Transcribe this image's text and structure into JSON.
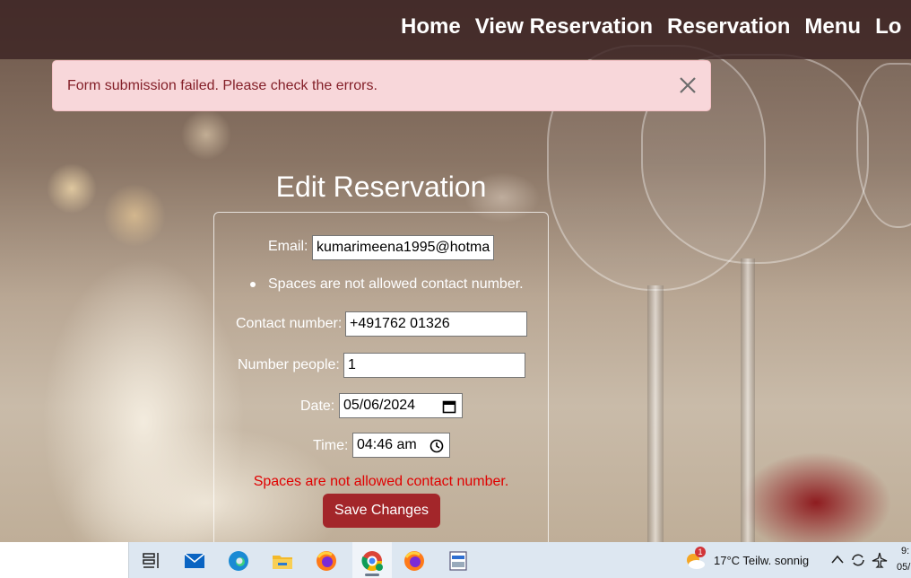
{
  "nav": {
    "items": [
      "Home",
      "View Reservation",
      "Reservation",
      "Menu",
      "Lo"
    ]
  },
  "alert": {
    "message": "Form submission failed. Please check the errors.",
    "close_icon": "close-icon"
  },
  "form": {
    "title": "Edit Reservation",
    "email_label": "Email:",
    "email_value": "kumarimeena1995@hotma",
    "contact_error_bullet": "Spaces are not allowed contact number.",
    "contact_label": "Contact number:",
    "contact_value": "+491762 01326",
    "people_label": "Number people:",
    "people_value": "1",
    "date_label": "Date:",
    "date_value": "05/06/2024",
    "time_label": "Time:",
    "time_value": "04:46 am",
    "error_message": "Spaces are not allowed contact number.",
    "save_label": "Save Changes"
  },
  "taskbar": {
    "apps": [
      "task-view-icon",
      "mail-icon",
      "edge-icon",
      "file-explorer-icon",
      "firefox-icon",
      "chrome-icon",
      "firefox-icon",
      "scanner-app-icon"
    ],
    "weather_badge": "1",
    "weather": "17°C  Teilw. sonnig",
    "clock_time": "9:",
    "clock_date": "05/"
  },
  "colors": {
    "alert_bg": "#f8d7da",
    "alert_text": "#842029",
    "button_bg": "#a3262a",
    "error_text": "#e00000"
  }
}
